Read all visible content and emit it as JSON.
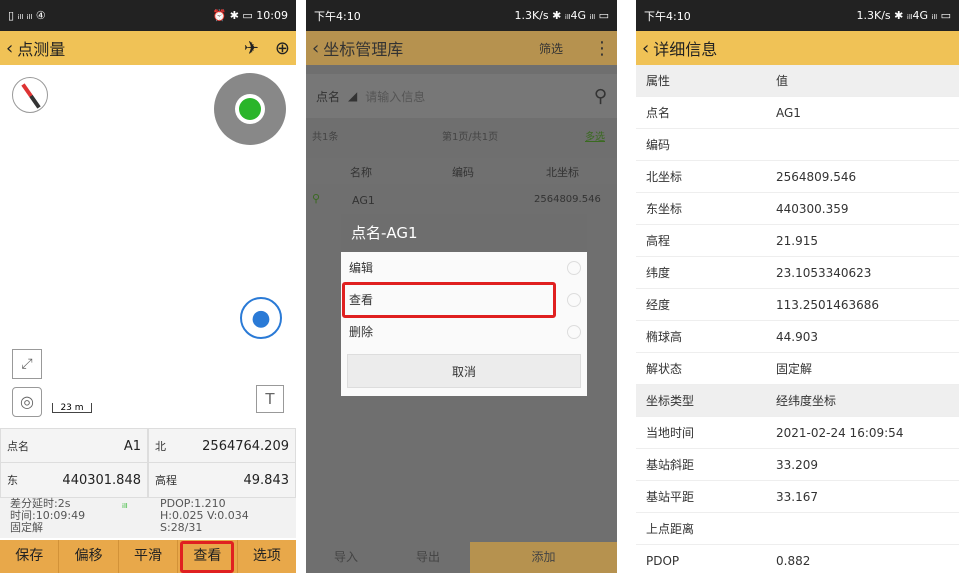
{
  "p1": {
    "status_right": "⏰ ✱ ▭ 10:09",
    "title": "点测量",
    "labels": {
      "dm": "点名",
      "bei": "北",
      "dong": "东",
      "gc": "高程"
    },
    "values": {
      "dm": "A1",
      "bei": "2564764.209",
      "dong": "440301.848",
      "gc": "49.843"
    },
    "info_left": [
      "差分延时:2s",
      "时间:10:09:49",
      "固定解"
    ],
    "info_right": [
      "PDOP:1.210",
      "H:0.025 V:0.034",
      "S:28/31"
    ],
    "scale": "23 m",
    "buttons": [
      "保存",
      "偏移",
      "平滑",
      "查看",
      "选项"
    ]
  },
  "p2": {
    "time": "下午4:10",
    "status_right": "1.3K/s ✱ ᵢₗₗ4G ᵢₗₗ ▭",
    "title": "坐标管理库",
    "filter": "筛选",
    "search_label": "点名",
    "search_placeholder": "请输入信息",
    "count": "共1条",
    "page": "第1页/共1页",
    "multi": "多选",
    "headers": [
      "名称",
      "编码",
      "北坐标"
    ],
    "row_name": "AG1",
    "row_north": "2564809.546",
    "dialog_title": "点名-AG1",
    "options": [
      "编辑",
      "查看",
      "删除"
    ],
    "cancel": "取消",
    "bottom": [
      "导入",
      "导出",
      "添加"
    ]
  },
  "p3": {
    "time": "下午4:10",
    "status_right": "1.3K/s ✱ ᵢₗₗ4G ᵢₗₗ ▭",
    "title": "详细信息",
    "rows": [
      [
        "属性",
        "值"
      ],
      [
        "点名",
        "AG1"
      ],
      [
        "编码",
        ""
      ],
      [
        "北坐标",
        "2564809.546"
      ],
      [
        "东坐标",
        "440300.359"
      ],
      [
        "高程",
        "21.915"
      ],
      [
        "纬度",
        "23.1053340623"
      ],
      [
        "经度",
        "113.2501463686"
      ],
      [
        "椭球高",
        "44.903"
      ],
      [
        "解状态",
        "固定解"
      ],
      [
        "坐标类型",
        "经纬度坐标"
      ],
      [
        "当地时间",
        "2021-02-24 16:09:54"
      ],
      [
        "基站斜距",
        "33.209"
      ],
      [
        "基站平距",
        "33.167"
      ],
      [
        "上点距离",
        ""
      ],
      [
        "PDOP",
        "0.882"
      ]
    ]
  }
}
